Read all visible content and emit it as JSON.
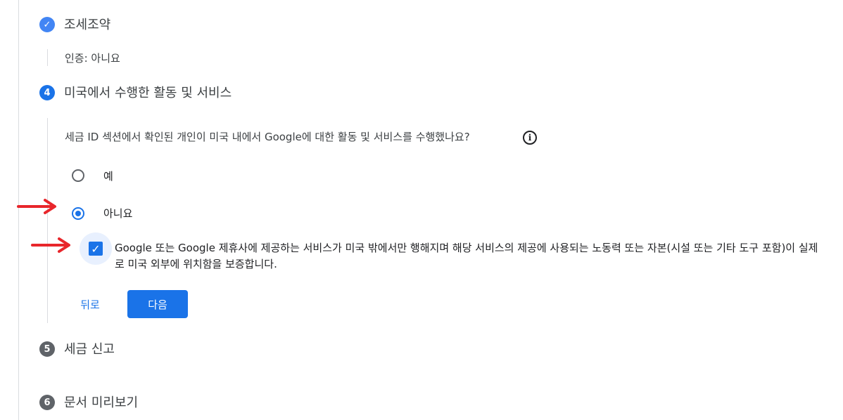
{
  "steps": {
    "terms": {
      "title": "조세조약",
      "summary": "인증: 아니요"
    },
    "activities": {
      "number": "4",
      "title": "미국에서 수행한 활동 및 서비스"
    },
    "tax_report": {
      "number": "5",
      "title": "세금 신고"
    },
    "preview": {
      "number": "6",
      "title": "문서 미리보기"
    }
  },
  "question": {
    "text": "세금 ID 섹션에서 확인된 개인이 미국 내에서 Google에 대한 활동 및 서비스를 수행했나요?",
    "info_icon": "info-icon"
  },
  "options": {
    "yes_label": "예",
    "no_label": "아니요",
    "selected": "아니요"
  },
  "confirmation": {
    "checked": true,
    "text": "Google 또는 Google 제휴사에 제공하는 서비스가 미국 밖에서만 행해지며 해당 서비스의 제공에 사용되는 노동력 또는 자본(시설 또는 기타 도구 포함)이 실제로 미국 외부에 위치함을 보증합니다."
  },
  "buttons": {
    "back": "뒤로",
    "next": "다음"
  },
  "colors": {
    "primary": "#1a73e8",
    "done": "#4285f4",
    "pending": "#5f6368",
    "annotation_arrow": "#e8262b"
  }
}
